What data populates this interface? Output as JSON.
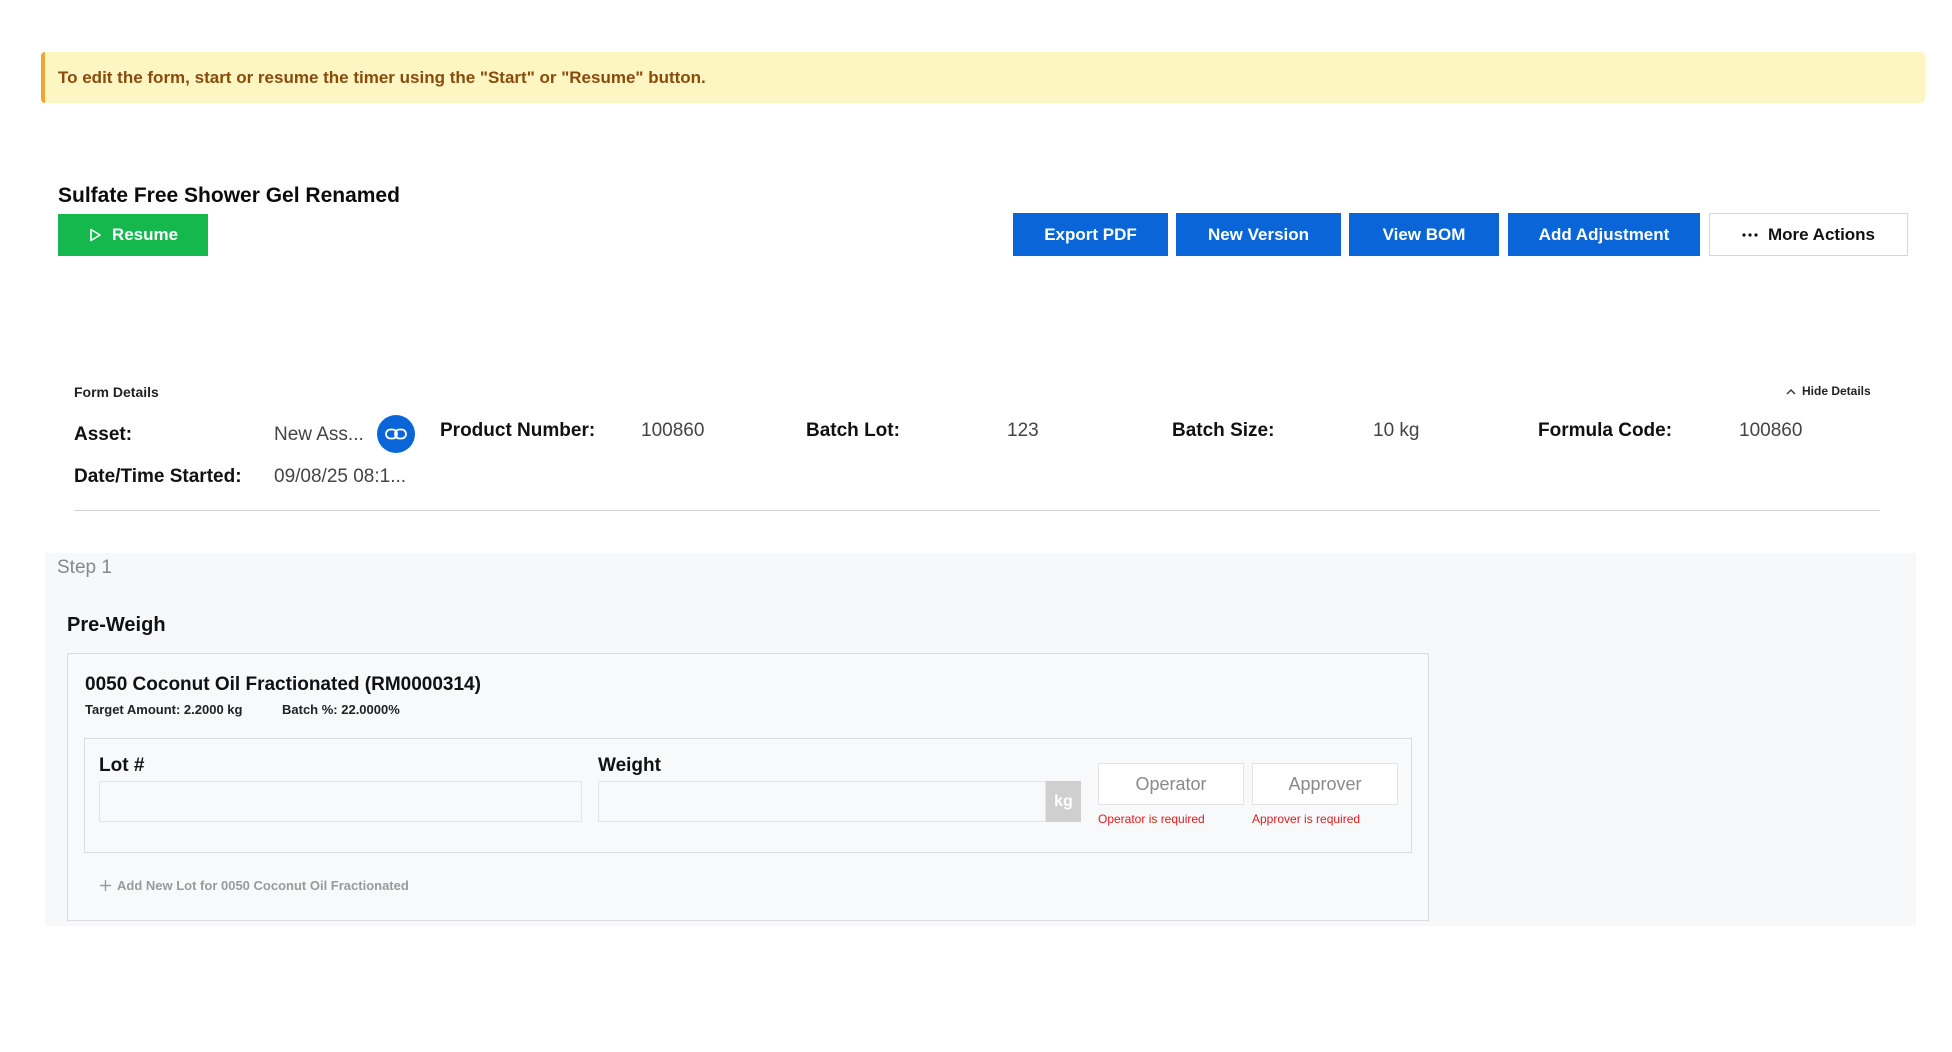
{
  "banner": {
    "text": "To edit the form, start or resume the timer using the \"Start\" or \"Resume\" button."
  },
  "header": {
    "title": "Sulfate Free Shower Gel Renamed",
    "resume_label": "Resume",
    "actions": {
      "export_pdf": "Export PDF",
      "new_version": "New Version",
      "view_bom": "View BOM",
      "add_adjustment": "Add Adjustment",
      "more_actions": "More Actions"
    }
  },
  "form_details": {
    "heading": "Form Details",
    "hide_details": "Hide Details",
    "asset_label": "Asset:",
    "asset_value": "New Ass...",
    "product_number_label": "Product Number:",
    "product_number_value": "100860",
    "batch_lot_label": "Batch Lot:",
    "batch_lot_value": "123",
    "batch_size_label": "Batch Size:",
    "batch_size_value": "10 kg",
    "formula_code_label": "Formula Code:",
    "formula_code_value": "100860",
    "date_started_label": "Date/Time Started:",
    "date_started_value": "09/08/25 08:1..."
  },
  "step": {
    "label": "Step 1",
    "section_title": "Pre-Weigh",
    "item": {
      "name": "0050 Coconut Oil Fractionated (RM0000314)",
      "target_amount": "Target Amount: 2.2000 kg",
      "batch_percent": "Batch %: 22.0000%",
      "lot_label": "Lot #",
      "lot_value": "",
      "weight_label": "Weight",
      "weight_value": "",
      "weight_unit": "kg",
      "operator_label": "Operator",
      "operator_error": "Operator is required",
      "approver_label": "Approver",
      "approver_error": "Approver is required",
      "add_lot": "Add New Lot for 0050 Coconut Oil Fractionated"
    }
  },
  "colors": {
    "primary": "#0a66d8",
    "success": "#14b84c",
    "warning_bg": "#fdf5c2",
    "warning_border": "#f2a531",
    "error": "#e21b1b"
  },
  "icons": [
    "play-icon",
    "ellipsis-icon",
    "chevron-up-icon",
    "link-icon",
    "plus-icon"
  ]
}
